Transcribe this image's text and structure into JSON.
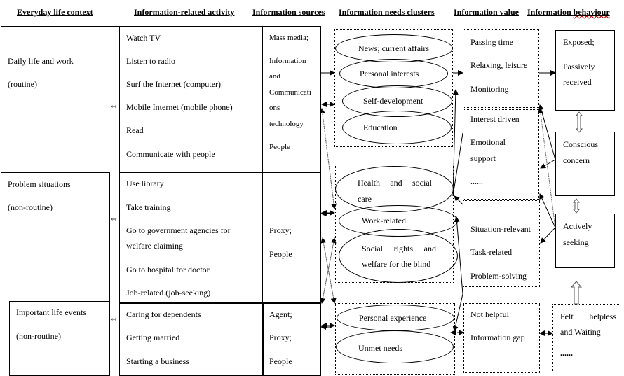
{
  "headers": {
    "context": "Everyday life context",
    "activity": "Information-related activity",
    "sources": "Information sources",
    "needs": "Information needs clusters",
    "value": "Information value",
    "behaviour_a": "Information ",
    "behaviour_b": "behaviour"
  },
  "contexts": [
    {
      "title": "Daily life and work",
      "subtitle": "(routine)"
    },
    {
      "title": "Problem situations",
      "subtitle": "(non-routine)"
    },
    {
      "title": "Important life events",
      "subtitle": "(non-routine)"
    }
  ],
  "activities": {
    "routine": [
      "Watch TV",
      "Listen to radio",
      "Surf the Internet (computer)",
      "Mobile Internet (mobile phone)",
      "Read",
      "Communicate with people"
    ],
    "problem": [
      "Use library",
      "Take training",
      "Go to government agencies for",
      "welfare claiming",
      "Go to hospital for doctor",
      "Job-related (job-seeking)"
    ],
    "events": [
      "Caring for dependents",
      "Getting married",
      "Starting a business"
    ]
  },
  "sources": {
    "routine": [
      "Mass media;",
      "Information",
      "and",
      "Communicati",
      "ons",
      "technology",
      "People"
    ],
    "problem": [
      "Proxy;",
      "People"
    ],
    "events": [
      "Agent;",
      "Proxy;",
      "People"
    ]
  },
  "needs": {
    "cluster1": [
      "News; current affairs",
      "Personal interests",
      "Self-development",
      "Education"
    ],
    "cluster2": {
      "health_a": [
        "Health",
        "and",
        "social"
      ],
      "health_b": "care",
      "work": "Work-related",
      "rights_a": [
        "Social",
        "rights",
        "and"
      ],
      "rights_b": "welfare for the blind"
    },
    "cluster3": [
      "Personal experience",
      "Unmet needs"
    ]
  },
  "values": {
    "group1": [
      "Passing time",
      "Relaxing, leisure",
      "Monitoring"
    ],
    "group2": [
      "Interest driven",
      "Emotional",
      "support",
      "......"
    ],
    "group3": [
      "Situation-relevant",
      "Task-related",
      "Problem-solving"
    ],
    "group4": [
      "Not helpful",
      "Information gap"
    ]
  },
  "behaviours": {
    "exposed": [
      "Exposed;",
      "Passively",
      "received"
    ],
    "conscious": [
      "Conscious",
      "concern"
    ],
    "active": [
      "Actively",
      "seeking"
    ],
    "helpless_a": [
      "Felt",
      "helpless"
    ],
    "helpless_b": "and Waiting",
    "helpless_c": "......"
  },
  "symbols": {
    "bidirectional": "⇔"
  }
}
